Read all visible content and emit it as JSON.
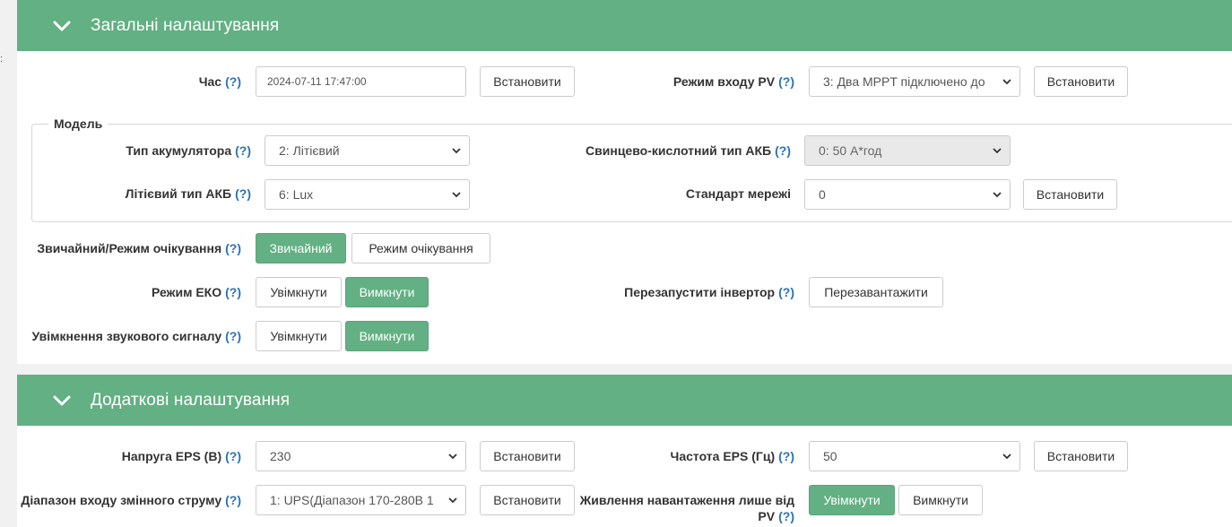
{
  "edge_mark": ":",
  "general": {
    "title": "Загальні налаштування",
    "time": {
      "label": "Час",
      "help": "(?)",
      "value": "2024-07-11 17:47:00",
      "set": "Встановити"
    },
    "pv_mode": {
      "label": "Режим входу PV",
      "help": "(?)",
      "value": "3: Два MPPT підключено до",
      "set": "Встановити"
    },
    "model": {
      "legend": "Модель",
      "battery_type": {
        "label": "Тип акумулятора",
        "help": "(?)",
        "value": "2: Літієвий"
      },
      "lead_acid_type": {
        "label": "Свинцево-кислотний тип АКБ",
        "help": "(?)",
        "value": "0: 50 А*год"
      },
      "lithium_type": {
        "label": "Літієвий тип АКБ",
        "help": "(?)",
        "value": "6: Lux"
      },
      "grid_standard": {
        "label": "Стандарт мережі",
        "value": "0",
        "set": "Встановити"
      }
    },
    "normal_standby": {
      "label": "Звичайний/Режим очікування",
      "help": "(?)",
      "normal": "Звичайний",
      "standby": "Режим очікування"
    },
    "eco_mode": {
      "label": "Режим ЕКО",
      "help": "(?)",
      "on": "Увімкнути",
      "off": "Вимкнути"
    },
    "restart": {
      "label": "Перезапустити інвертор",
      "help": "(?)",
      "button": "Перезавантажити"
    },
    "buzzer": {
      "label": "Увімкнення звукового сигналу",
      "help": "(?)",
      "on": "Увімкнути",
      "off": "Вимкнути"
    }
  },
  "additional": {
    "title": "Додаткові налаштування",
    "eps_voltage": {
      "label": "Напруга EPS (В)",
      "help": "(?)",
      "value": "230",
      "set": "Встановити"
    },
    "eps_frequency": {
      "label": "Частота EPS (Гц)",
      "help": "(?)",
      "value": "50",
      "set": "Встановити"
    },
    "ac_range": {
      "label": "Діапазон входу змінного струму",
      "help": "(?)",
      "value": "1: UPS(Діапазон 170-280В 1",
      "set": "Встановити"
    },
    "pv_only_load": {
      "label_line1": "Живлення навантаження лише від",
      "label_line2": "PV",
      "help": "(?)",
      "on": "Увімкнути",
      "off": "Вимкнути"
    }
  },
  "colors": {
    "header": "#62b083",
    "active_button": "#62b083",
    "help_link": "#2a72b5"
  }
}
